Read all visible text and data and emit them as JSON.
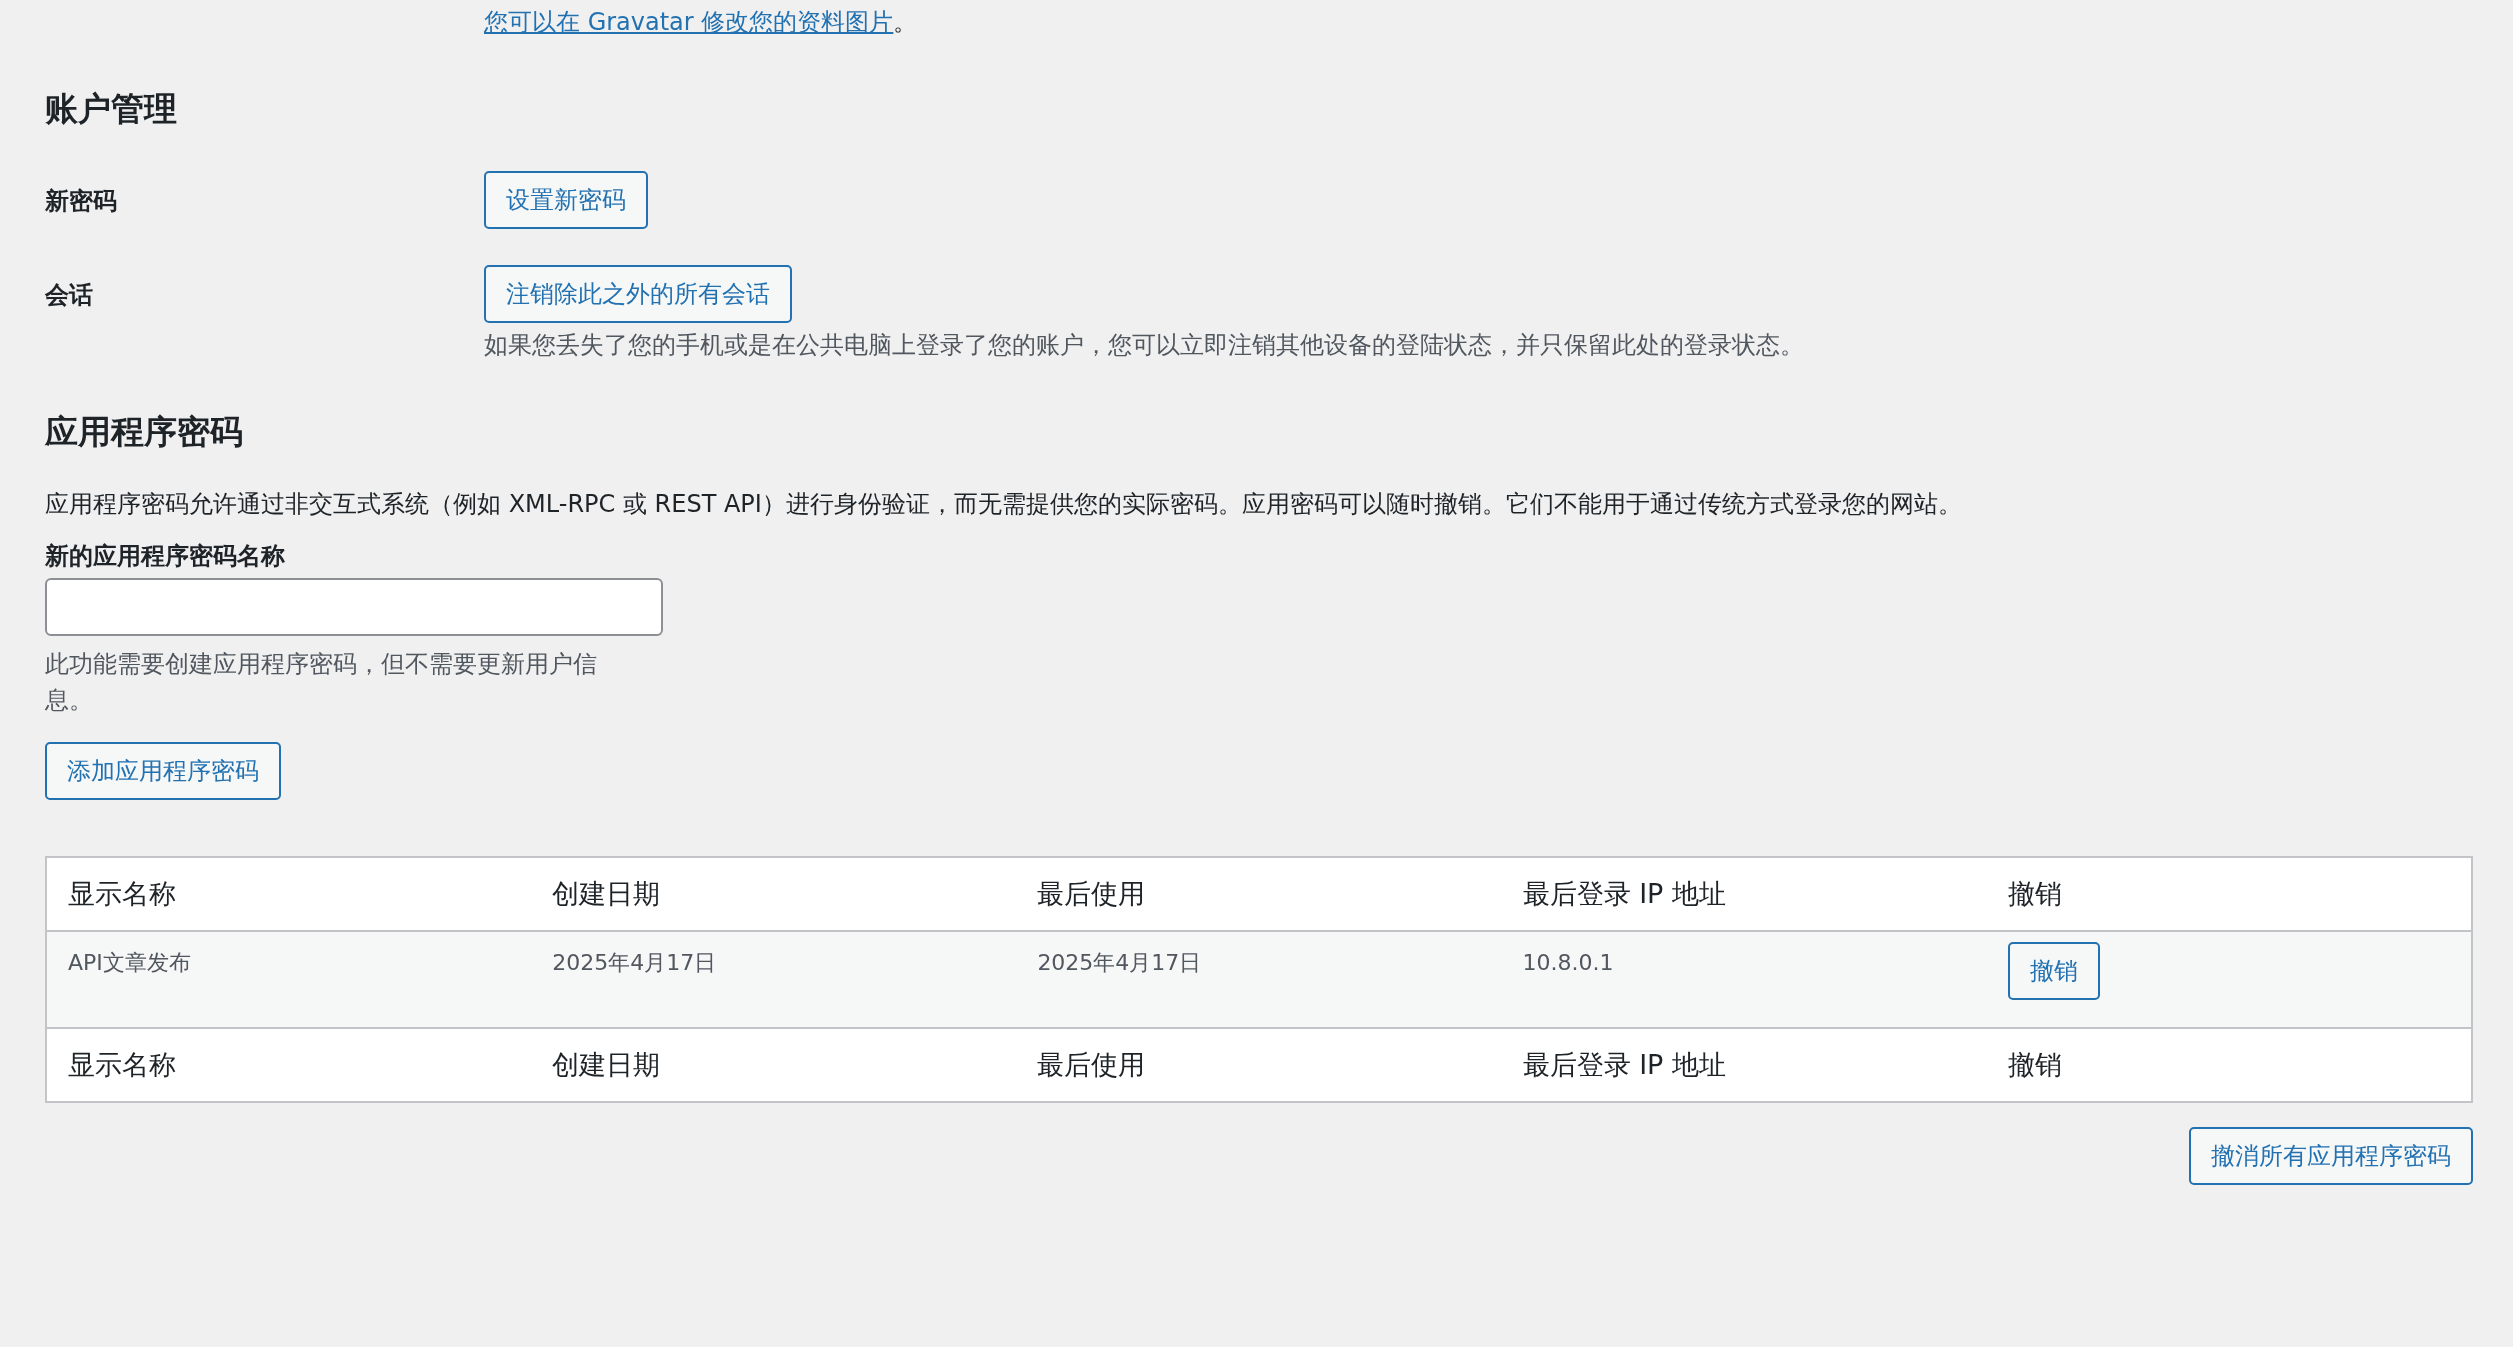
{
  "gravatar_note": {
    "link": "您可以在 Gravatar 修改您的资料图片",
    "suffix": "。"
  },
  "account_management": {
    "heading": "账户管理",
    "rows": [
      {
        "label": "新密码",
        "button": "设置新密码"
      },
      {
        "label": "会话",
        "button": "注销除此之外的所有会话",
        "description": "如果您丢失了您的手机或是在公共电脑上登录了您的账户，您可以立即注销其他设备的登陆状态，并只保留此处的登录状态。"
      }
    ]
  },
  "application_passwords": {
    "heading": "应用程序密码",
    "description": "应用程序密码允许通过非交互式系统（例如 XML-RPC 或 REST API）进行身份验证，而无需提供您的实际密码。应用密码可以随时撤销。它们不能用于通过传统方式登录您的网站。",
    "name_field": {
      "label": "新的应用程序密码名称",
      "help": "此功能需要创建应用程序密码，但不需要更新用户信息。"
    },
    "add_button": "添加应用程序密码",
    "table": {
      "columns": [
        "显示名称",
        "创建日期",
        "最后使用",
        "最后登录 IP 地址",
        "撤销"
      ],
      "rows": [
        {
          "cells": [
            "API文章发布",
            "2025年4月17日",
            "2025年4月17日",
            "10.8.0.1"
          ],
          "revoke_button": "撤销"
        }
      ],
      "footer_columns": [
        "显示名称",
        "创建日期",
        "最后使用",
        "最后登录 IP 地址",
        "撤销"
      ]
    },
    "revoke_all_button": "撤消所有应用程序密码"
  }
}
